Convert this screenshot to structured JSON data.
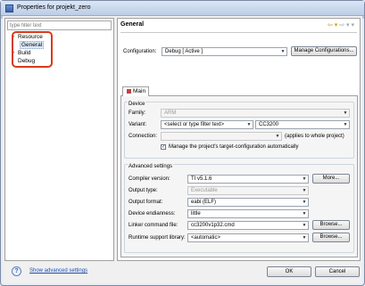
{
  "window": {
    "title": "Properties for projekt_zero"
  },
  "filter": {
    "placeholder": "type filter text"
  },
  "tree": {
    "items": [
      {
        "label": "Resource"
      },
      {
        "label": "General"
      },
      {
        "label": "Build"
      },
      {
        "label": "Debug"
      }
    ]
  },
  "header": {
    "title": "General",
    "back": "⇦ ▾",
    "forward": "⇨ ▾ ▾"
  },
  "configuration": {
    "label": "Configuration:",
    "value": "Debug  [ Active ]",
    "manage_button": "Manage Configurations..."
  },
  "tabs": [
    {
      "label": "Main"
    }
  ],
  "device": {
    "group_title": "Device",
    "family_label": "Family:",
    "family_value": "ARM",
    "variant_label": "Variant:",
    "variant_filter": "<select or type filter text>",
    "variant_value": "CC3200",
    "connection_label": "Connection:",
    "connection_note": "(applies to whole project)",
    "manage_checkbox_label": "Manage the project's target-configuration automatically",
    "manage_checked": true
  },
  "advanced": {
    "group_title": "Advanced settings",
    "compiler_label": "Compiler version:",
    "compiler_value": "TI v5.1.6",
    "compiler_button": "More...",
    "output_type_label": "Output type:",
    "output_type_value": "Executable",
    "output_format_label": "Output format:",
    "output_format_value": "eabi (ELF)",
    "endianness_label": "Device endianness:",
    "endianness_value": "little",
    "linker_label": "Linker command file:",
    "linker_value": "cc3200v1p32.cmd",
    "linker_button": "Browse...",
    "runtime_label": "Runtime support library:",
    "runtime_value": "<automatic>",
    "runtime_button": "Browse..."
  },
  "footer": {
    "help_icon": "?",
    "advanced_link": "Show advanced settings",
    "ok_button": "OK",
    "cancel_button": "Cancel"
  },
  "colors": {
    "highlight": "#d83a1a",
    "link": "#1c4fb0"
  }
}
